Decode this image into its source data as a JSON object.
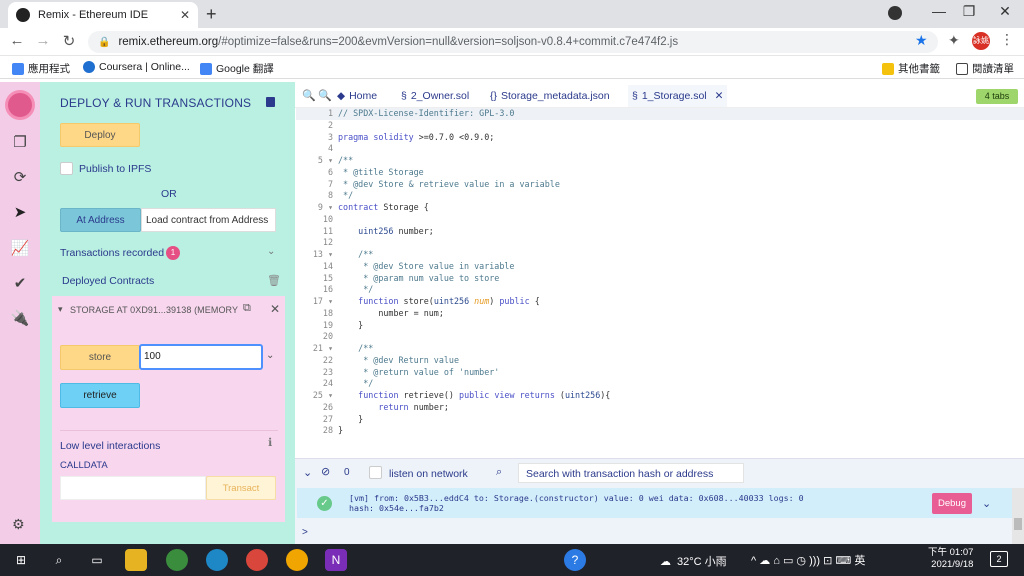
{
  "browser": {
    "tab_title": "Remix - Ethereum IDE",
    "url_host": "remix.ethereum.org",
    "url_rest": "/#optimize=false&runs=200&evmVersion=null&version=soljson-v0.8.4+commit.c7e474f2.js",
    "profile_label": "詠姚",
    "bookmarks": [
      "應用程式",
      "Coursera | Online...",
      "Google 翻譯"
    ],
    "bookmarks_right": [
      "其他書籤",
      "閱讀清單"
    ]
  },
  "side": {
    "title": "DEPLOY & RUN TRANSACTIONS",
    "deploy_label": "Deploy",
    "publish_label": "Publish to IPFS",
    "or_label": "OR",
    "at_address_label": "At Address",
    "load_address_label": "Load contract from Address",
    "tx_recorded_label": "Transactions recorded",
    "tx_recorded_count": "1",
    "deployed_label": "Deployed Contracts",
    "contract_name": "STORAGE AT 0XD91...39138 (MEMORY",
    "store_label": "store",
    "store_value": "100",
    "retrieve_label": "retrieve",
    "low_level_label": "Low level interactions",
    "calldata_label": "CALLDATA",
    "transact_label": "Transact"
  },
  "editor": {
    "tabs": [
      "Home",
      "2_Owner.sol",
      "Storage_metadata.json",
      "1_Storage.sol"
    ],
    "tabs_count": "4 tabs",
    "line_numbers": "1\n2\n3\n4\n5 ▾\n6\n7\n8\n9 ▾\n10\n11\n12\n13 ▾\n14\n15\n16\n17 ▾\n18\n19\n20\n21 ▾\n22\n23\n24\n25 ▾\n26\n27\n28",
    "code_lines": [
      "// SPDX-License-Identifier: GPL-3.0",
      "",
      "pragma solidity >=0.7.0 <0.9.0;",
      "",
      "/**",
      " * @title Storage",
      " * @dev Store & retrieve value in a variable",
      " */",
      "contract Storage {",
      "",
      "    uint256 number;",
      "",
      "    /**",
      "     * @dev Store value in variable",
      "     * @param num value to store",
      "     */",
      "    function store(uint256 num) public {",
      "        number = num;",
      "    }",
      "",
      "    /**",
      "     * @dev Return value",
      "     * @return value of 'number'",
      "     */",
      "    function retrieve() public view returns (uint256){",
      "        return number;",
      "    }",
      "}"
    ]
  },
  "terminal": {
    "count": "0",
    "listen_label": "listen on network",
    "search_placeholder": "Search with transaction hash or address",
    "log_line1": "[vm] from: 0x5B3...eddC4 to: Storage.(constructor) value: 0 wei data: 0x608...40033 logs: 0",
    "log_line2": "hash: 0x54e...fa7b2",
    "debug_label": "Debug",
    "prompt": ">"
  },
  "taskbar": {
    "weather": "32°C 小雨",
    "ime": "英",
    "time": "下午 01:07",
    "date": "2021/9/18",
    "notifications": "2"
  }
}
